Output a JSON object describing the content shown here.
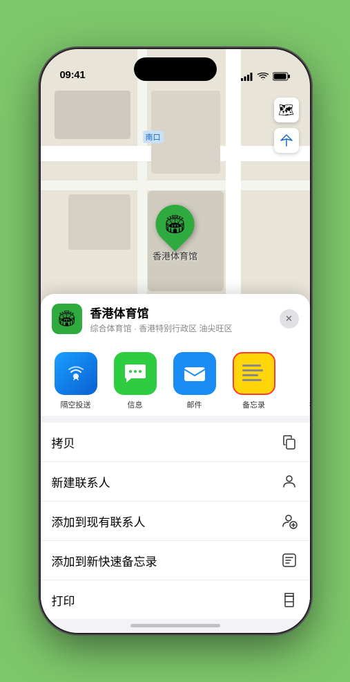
{
  "status_bar": {
    "time": "09:41",
    "signal": "●●●●",
    "wifi": "wifi",
    "battery": "battery"
  },
  "map": {
    "label_nankou": "南口"
  },
  "venue": {
    "name": "香港体育馆",
    "subtitle": "综合体育馆 · 香港特别行政区 油尖旺区",
    "pin_label": "香港体育馆"
  },
  "share_items": [
    {
      "id": "airdrop",
      "label": "隔空投送",
      "type": "airdrop"
    },
    {
      "id": "messages",
      "label": "信息",
      "type": "messages"
    },
    {
      "id": "mail",
      "label": "邮件",
      "type": "mail"
    },
    {
      "id": "notes",
      "label": "备忘录",
      "type": "notes"
    },
    {
      "id": "more",
      "label": "提",
      "type": "more"
    }
  ],
  "actions": [
    {
      "label": "拷贝",
      "icon": "copy"
    },
    {
      "label": "新建联系人",
      "icon": "person"
    },
    {
      "label": "添加到现有联系人",
      "icon": "person-add"
    },
    {
      "label": "添加到新快速备忘录",
      "icon": "quick-note"
    },
    {
      "label": "打印",
      "icon": "print"
    }
  ],
  "controls": {
    "map_icon": "🗺",
    "location_icon": "↗"
  }
}
